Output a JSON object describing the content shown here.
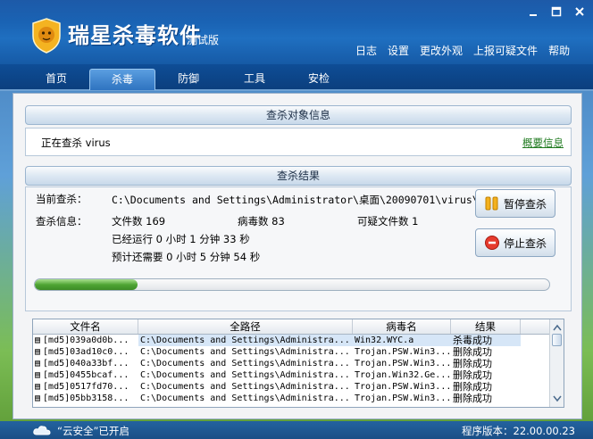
{
  "app": {
    "title": "瑞星杀毒软件",
    "subtitle": "测试版"
  },
  "top_menu": [
    "日志",
    "设置",
    "更改外观",
    "上报可疑文件",
    "帮助"
  ],
  "nav": {
    "tabs": [
      "首页",
      "杀毒",
      "防御",
      "工具",
      "安检"
    ],
    "active": "杀毒"
  },
  "scan_target": {
    "header": "查杀对象信息",
    "status": "正在查杀 virus",
    "summary_link": "概要信息"
  },
  "scan_result": {
    "header": "查杀结果",
    "current_label": "当前查杀：",
    "current_path": "C:\\Documents and Settings\\Administrator\\桌面\\20090701\\virus\\[...",
    "info_label": "查杀信息：",
    "files_text": "文件数 169",
    "virus_text": "病毒数 83",
    "suspicious_text": "可疑文件数 1",
    "elapsed_text": "已经运行 0 小时 1 分钟 33  秒",
    "remaining_text": "预计还需要 0 小时 5 分钟 54  秒",
    "pause_label": "暂停查杀",
    "stop_label": "停止查杀",
    "progress": 0.2
  },
  "table": {
    "columns": [
      "文件名",
      "全路径",
      "病毒名",
      "结果"
    ],
    "rows": [
      [
        "[md5]039a0d0b...",
        "C:\\Documents and Settings\\Administra...",
        "Win32.WYC.a",
        "杀毒成功"
      ],
      [
        "[md5]03ad10c0...",
        "C:\\Documents and Settings\\Administra...",
        "Trojan.PSW.Win3...",
        "删除成功"
      ],
      [
        "[md5]040a33bf...",
        "C:\\Documents and Settings\\Administra...",
        "Trojan.PSW.Win3...",
        "删除成功"
      ],
      [
        "[md5]0455bcaf...",
        "C:\\Documents and Settings\\Administra...",
        "Trojan.Win32.Ge...",
        "删除成功"
      ],
      [
        "[md5]0517fd70...",
        "C:\\Documents and Settings\\Administra...",
        "Trojan.PSW.Win3...",
        "删除成功"
      ],
      [
        "[md5]05bb3158...",
        "C:\\Documents and Settings\\Administra...",
        "Trojan.PSW.Win3...",
        "删除成功"
      ]
    ]
  },
  "footer": {
    "cloud_status": "“云安全”已开启",
    "version": "程序版本：22.00.00.23"
  },
  "colors": {
    "header_blue": "#1a63b4",
    "link_green": "#1f7a1f",
    "progress_green": "#4fa534"
  }
}
